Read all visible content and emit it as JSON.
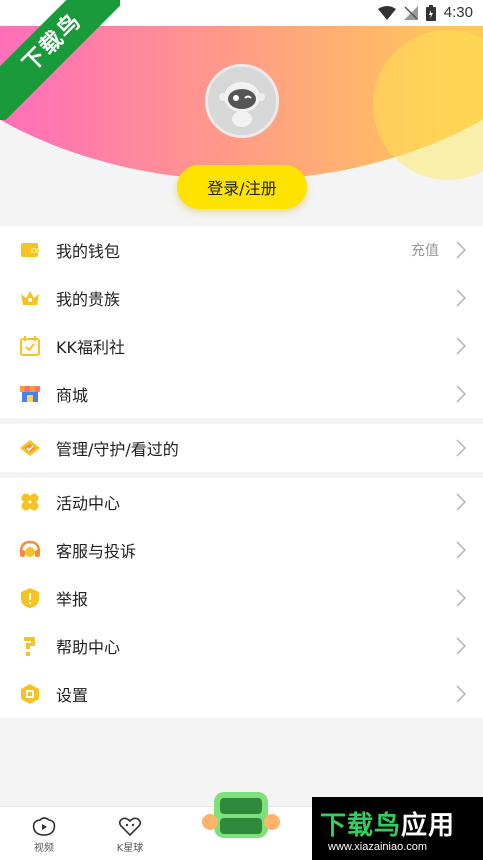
{
  "status_bar": {
    "time": "4:30"
  },
  "watermark": {
    "text": "下载鸟"
  },
  "profile": {
    "login_label": "登录/注册"
  },
  "menu_group_1": [
    {
      "label": "我的钱包",
      "extra": "充值",
      "icon": "wallet-icon"
    },
    {
      "label": "我的贵族",
      "extra": "",
      "icon": "crown-icon"
    },
    {
      "label": "KK福利社",
      "extra": "",
      "icon": "calendar-check-icon"
    },
    {
      "label": "商城",
      "extra": "",
      "icon": "shop-icon"
    }
  ],
  "menu_group_2": [
    {
      "label": "管理/守护/看过的",
      "icon": "diamond-icon"
    }
  ],
  "menu_group_3": [
    {
      "label": "活动中心",
      "icon": "activity-icon"
    },
    {
      "label": "客服与投诉",
      "icon": "headset-icon"
    },
    {
      "label": "举报",
      "icon": "report-icon"
    },
    {
      "label": "帮助中心",
      "icon": "help-icon"
    },
    {
      "label": "设置",
      "icon": "settings-icon"
    }
  ],
  "bottom_nav": {
    "video_label": "视频",
    "planet_label": "K星球"
  },
  "brand": {
    "title_green": "下载鸟",
    "title_white": "应用",
    "url": "www.xiazainiao.com"
  },
  "colors": {
    "accent": "#ffe300",
    "icon_yellow": "#f6c324",
    "brand_green": "#1a9a3a"
  }
}
